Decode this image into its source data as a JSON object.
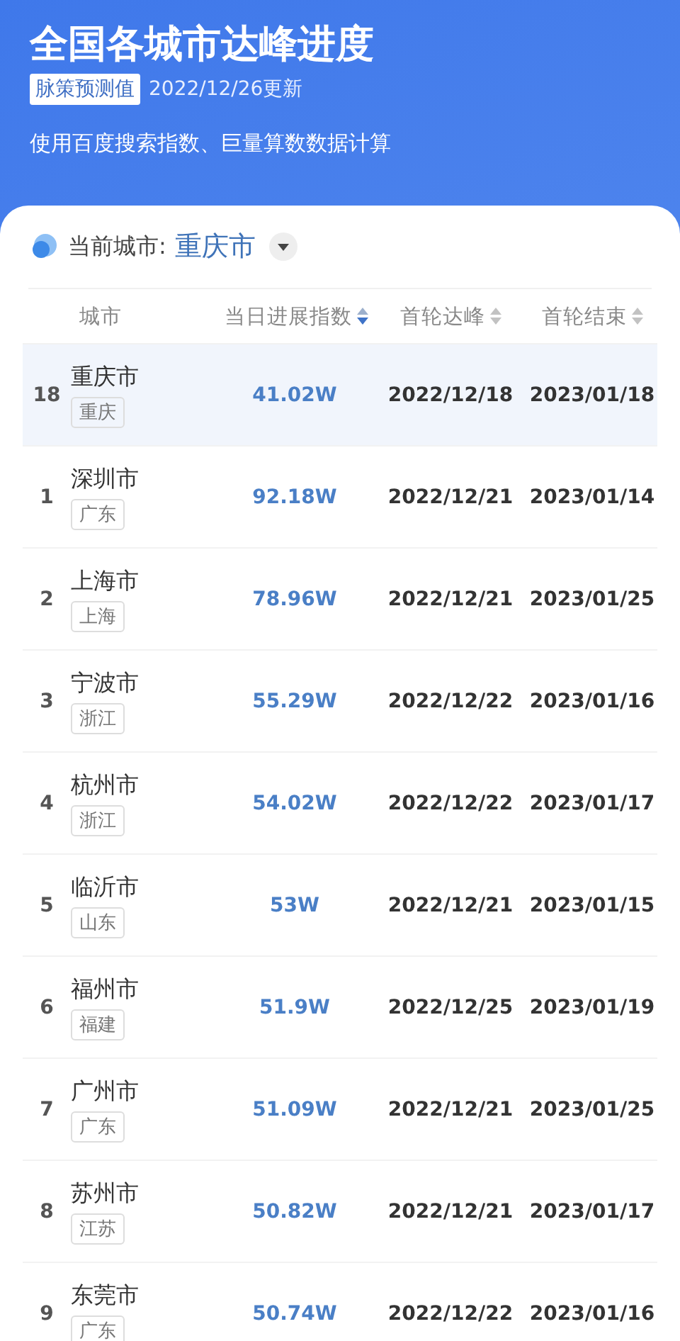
{
  "header": {
    "title": "全国各城市达峰进度",
    "tag": "脉策预测值",
    "updated": "2022/12/26更新",
    "subtitle": "使用百度搜索指数、巨量算数数据计算"
  },
  "city_picker": {
    "label": "当前城市:",
    "value": "重庆市"
  },
  "table": {
    "columns": [
      {
        "label": "城市",
        "sortable": false
      },
      {
        "label": "当日进展指数",
        "sorted": true,
        "sortable": true
      },
      {
        "label": "首轮达峰",
        "sorted": false,
        "sortable": true
      },
      {
        "label": "首轮结束",
        "sorted": false,
        "sortable": true
      }
    ],
    "rows": [
      {
        "rank": "18",
        "city": "重庆市",
        "province": "重庆",
        "index": "41.02W",
        "peak": "2022/12/18",
        "end": "2023/01/18",
        "highlighted": true
      },
      {
        "rank": "1",
        "city": "深圳市",
        "province": "广东",
        "index": "92.18W",
        "peak": "2022/12/21",
        "end": "2023/01/14",
        "highlighted": false
      },
      {
        "rank": "2",
        "city": "上海市",
        "province": "上海",
        "index": "78.96W",
        "peak": "2022/12/21",
        "end": "2023/01/25",
        "highlighted": false
      },
      {
        "rank": "3",
        "city": "宁波市",
        "province": "浙江",
        "index": "55.29W",
        "peak": "2022/12/22",
        "end": "2023/01/16",
        "highlighted": false
      },
      {
        "rank": "4",
        "city": "杭州市",
        "province": "浙江",
        "index": "54.02W",
        "peak": "2022/12/22",
        "end": "2023/01/17",
        "highlighted": false
      },
      {
        "rank": "5",
        "city": "临沂市",
        "province": "山东",
        "index": "53W",
        "peak": "2022/12/21",
        "end": "2023/01/15",
        "highlighted": false
      },
      {
        "rank": "6",
        "city": "福州市",
        "province": "福建",
        "index": "51.9W",
        "peak": "2022/12/25",
        "end": "2023/01/19",
        "highlighted": false
      },
      {
        "rank": "7",
        "city": "广州市",
        "province": "广东",
        "index": "51.09W",
        "peak": "2022/12/21",
        "end": "2023/01/25",
        "highlighted": false
      },
      {
        "rank": "8",
        "city": "苏州市",
        "province": "江苏",
        "index": "50.82W",
        "peak": "2022/12/21",
        "end": "2023/01/17",
        "highlighted": false
      },
      {
        "rank": "9",
        "city": "东莞市",
        "province": "广东",
        "index": "50.74W",
        "peak": "2022/12/22",
        "end": "2023/01/16",
        "highlighted": false
      }
    ]
  }
}
